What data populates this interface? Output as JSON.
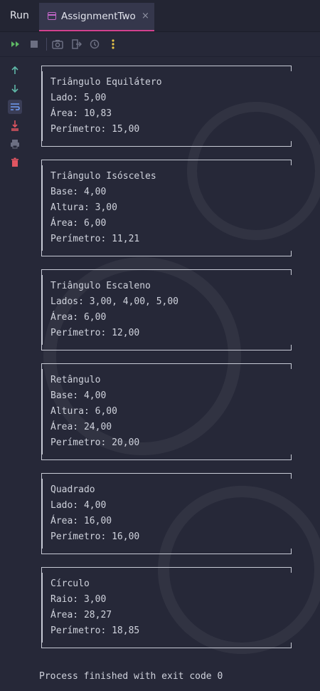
{
  "header": {
    "run_label": "Run",
    "tab_title": "AssignmentTwo",
    "tab_close": "×"
  },
  "toolbar": {
    "icons": [
      "rerun-icon",
      "stop-icon",
      "camera-icon",
      "exit-icon",
      "settings-icon",
      "more-icon"
    ]
  },
  "gutter": {
    "icons": [
      "arrow-up-icon",
      "arrow-down-icon",
      "soft-wrap-icon",
      "scroll-to-end-icon",
      "print-icon",
      "trash-icon"
    ]
  },
  "console": {
    "cards": [
      {
        "title": "Triângulo Equilátero",
        "lines": [
          "Lado: 5,00",
          "Área: 10,83",
          "Perímetro: 15,00"
        ]
      },
      {
        "title": "Triângulo Isósceles",
        "lines": [
          "Base: 4,00",
          "Altura: 3,00",
          "Área: 6,00",
          "Perímetro: 11,21"
        ]
      },
      {
        "title": "Triângulo Escaleno",
        "lines": [
          "Lados: 3,00, 4,00, 5,00",
          "Área: 6,00",
          "Perímetro: 12,00"
        ]
      },
      {
        "title": "Retângulo",
        "lines": [
          "Base: 4,00",
          "Altura: 6,00",
          "Área: 24,00",
          "Perímetro: 20,00"
        ]
      },
      {
        "title": "Quadrado",
        "lines": [
          "Lado: 4,00",
          "Área: 16,00",
          "Perímetro: 16,00"
        ]
      },
      {
        "title": "Círculo",
        "lines": [
          "Raio: 3,00",
          "Área: 28,27",
          "Perímetro: 18,85"
        ]
      }
    ],
    "process_text": "Process finished with exit code 0"
  },
  "colors": {
    "background": "#262838",
    "tab_accent": "#d2418f",
    "text": "#c8cbd6",
    "green": "#5fb865",
    "red": "#e05561"
  }
}
